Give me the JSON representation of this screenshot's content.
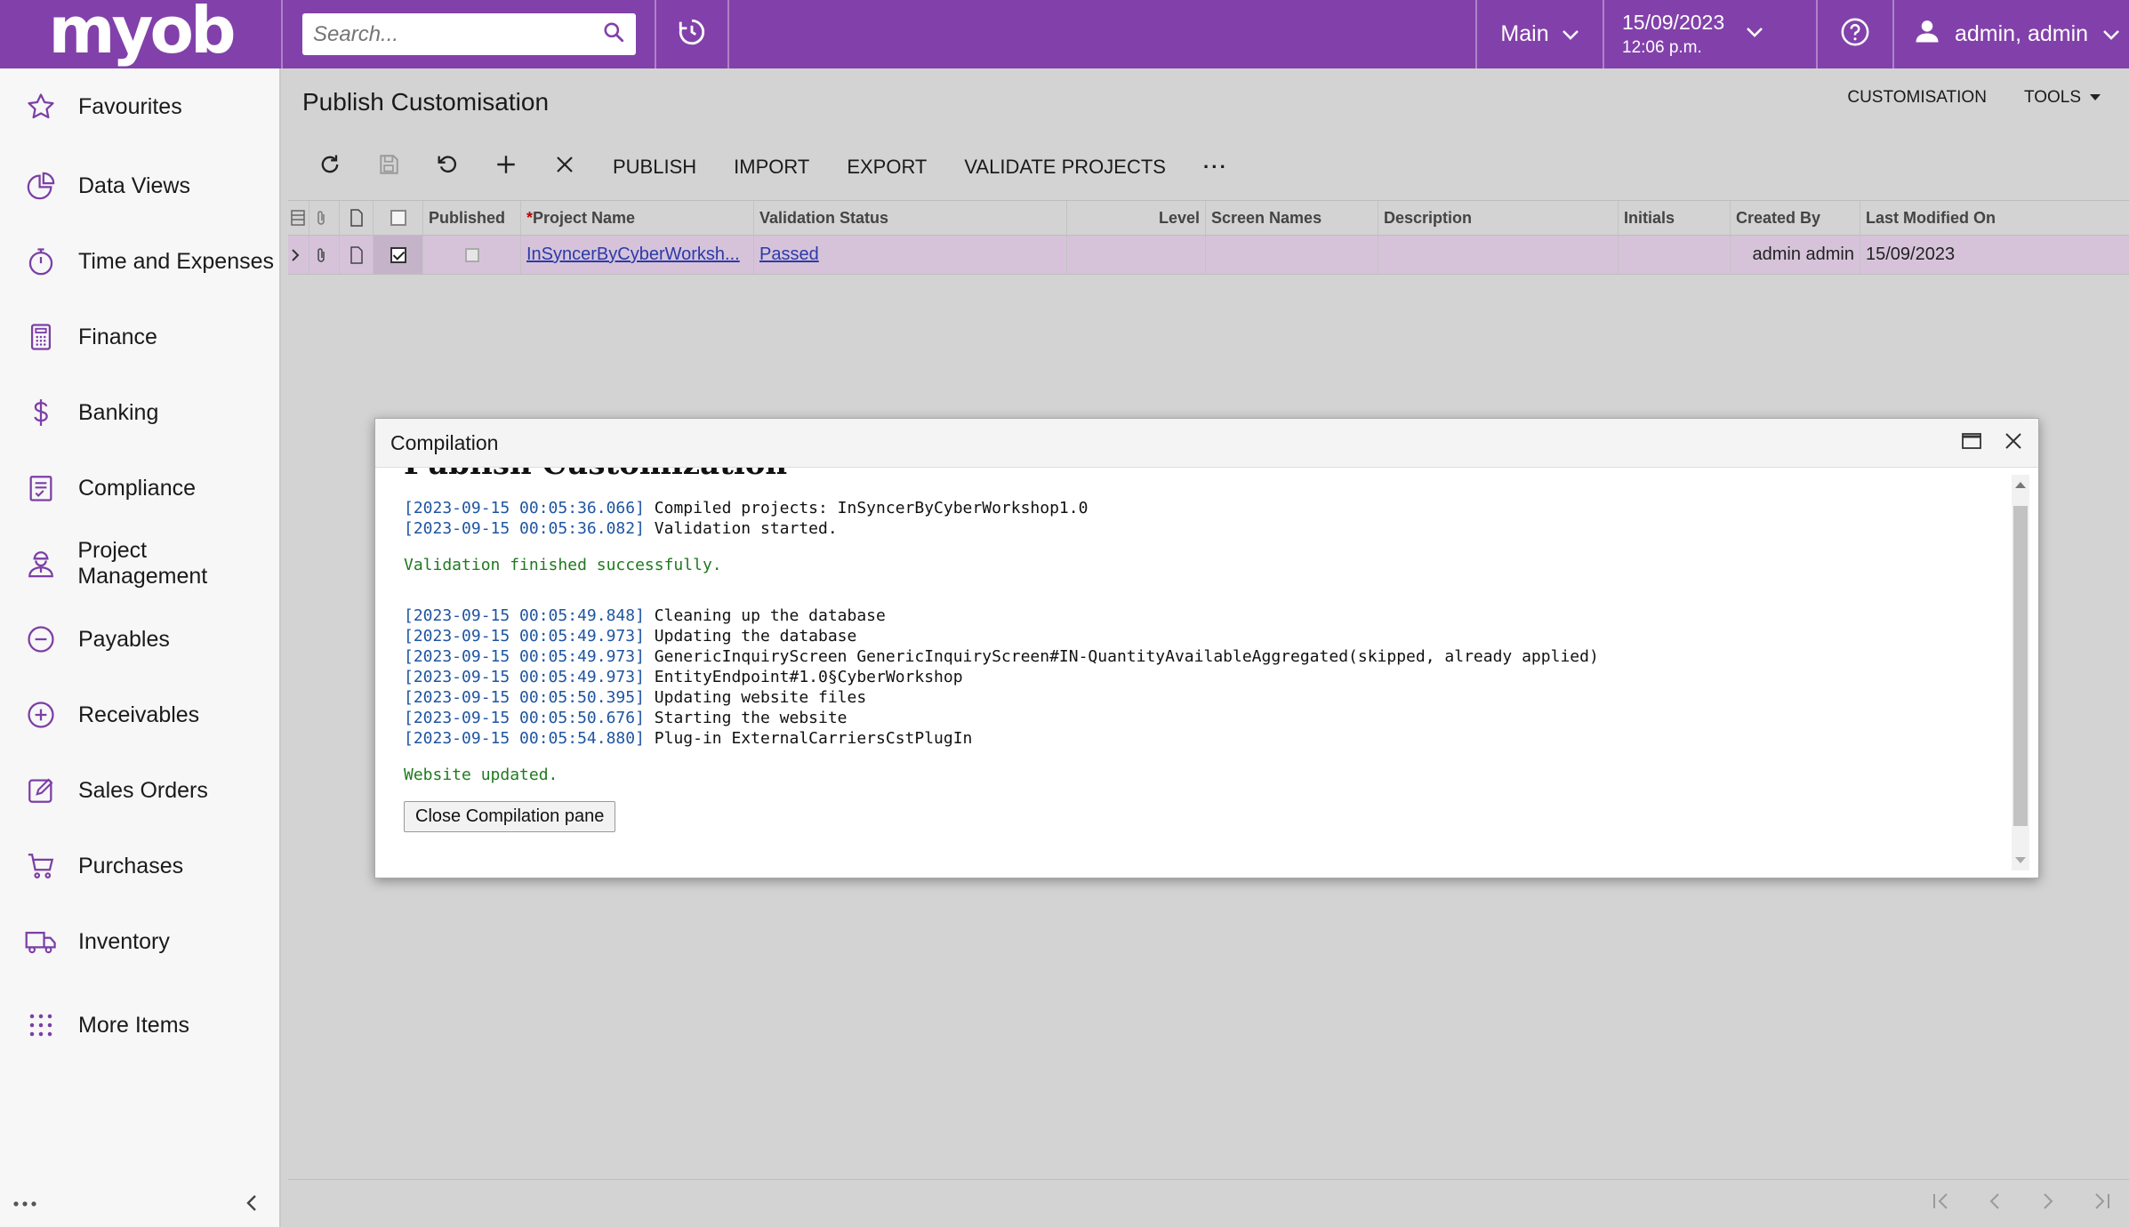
{
  "app": {
    "logo": "myob"
  },
  "topbar": {
    "search_placeholder": "Search...",
    "company": "Main",
    "date": "15/09/2023",
    "time": "12:06 p.m.",
    "user": "admin, admin"
  },
  "sidebar": {
    "items": [
      {
        "label": "Favourites",
        "icon": "star-icon"
      },
      {
        "label": "Data Views",
        "icon": "pie-chart-icon"
      },
      {
        "label": "Time and Expenses",
        "icon": "stopwatch-icon"
      },
      {
        "label": "Finance",
        "icon": "calculator-icon"
      },
      {
        "label": "Banking",
        "icon": "dollar-icon"
      },
      {
        "label": "Compliance",
        "icon": "checklist-icon"
      },
      {
        "label": "Project Management",
        "icon": "worker-icon"
      },
      {
        "label": "Payables",
        "icon": "minus-circle-icon"
      },
      {
        "label": "Receivables",
        "icon": "plus-circle-icon"
      },
      {
        "label": "Sales Orders",
        "icon": "edit-icon"
      },
      {
        "label": "Purchases",
        "icon": "cart-icon"
      },
      {
        "label": "Inventory",
        "icon": "truck-icon"
      },
      {
        "label": "More Items",
        "icon": "grid-dots-icon"
      }
    ]
  },
  "page": {
    "title": "Publish Customisation",
    "links": {
      "customisation": "CUSTOMISATION",
      "tools": "TOOLS"
    }
  },
  "toolbar": {
    "publish": "PUBLISH",
    "import": "IMPORT",
    "export": "EXPORT",
    "validate": "VALIDATE PROJECTS",
    "more": "···"
  },
  "grid": {
    "columns": {
      "published": "Published",
      "required_mark": "*",
      "project_name": "Project Name",
      "validation_status": "Validation Status",
      "level": "Level",
      "screen_names": "Screen Names",
      "description": "Description",
      "initials": "Initials",
      "created_by": "Created By",
      "last_modified": "Last Modified On"
    },
    "rows": [
      {
        "project_name": "InSyncerByCyberWorksh...",
        "validation_status": "Passed",
        "created_by": "admin admin",
        "last_modified": "15/09/2023",
        "selected": true,
        "published": false
      }
    ]
  },
  "dialog": {
    "title": "Compilation",
    "heading": "Publish Customization",
    "log1": [
      {
        "ts": "[2023-09-15 00:05:36.066]",
        "msg": " Compiled projects: InSyncerByCyberWorkshop1.0"
      },
      {
        "ts": "[2023-09-15 00:05:36.082]",
        "msg": " Validation started."
      }
    ],
    "validation_ok": "Validation finished successfully.",
    "log2": [
      {
        "ts": "[2023-09-15 00:05:49.848]",
        "msg": " Cleaning up the database"
      },
      {
        "ts": "[2023-09-15 00:05:49.973]",
        "msg": " Updating the database"
      },
      {
        "ts": "[2023-09-15 00:05:49.973]",
        "msg": " GenericInquiryScreen GenericInquiryScreen#IN-QuantityAvailableAggregated(skipped, already applied)"
      },
      {
        "ts": "[2023-09-15 00:05:49.973]",
        "msg": " EntityEndpoint#1.0§CyberWorkshop"
      },
      {
        "ts": "[2023-09-15 00:05:50.395]",
        "msg": " Updating website files"
      },
      {
        "ts": "[2023-09-15 00:05:50.676]",
        "msg": " Starting the website"
      },
      {
        "ts": "[2023-09-15 00:05:54.880]",
        "msg": " Plug-in ExternalCarriersCstPlugIn"
      }
    ],
    "website_ok": "Website updated.",
    "close_button": "Close Compilation pane"
  },
  "colors": {
    "brand": "#8241aa",
    "selected_row": "#d6c3da",
    "link": "#2a3aa8",
    "success": "#1f7a1f",
    "timestamp": "#1f55a0"
  }
}
